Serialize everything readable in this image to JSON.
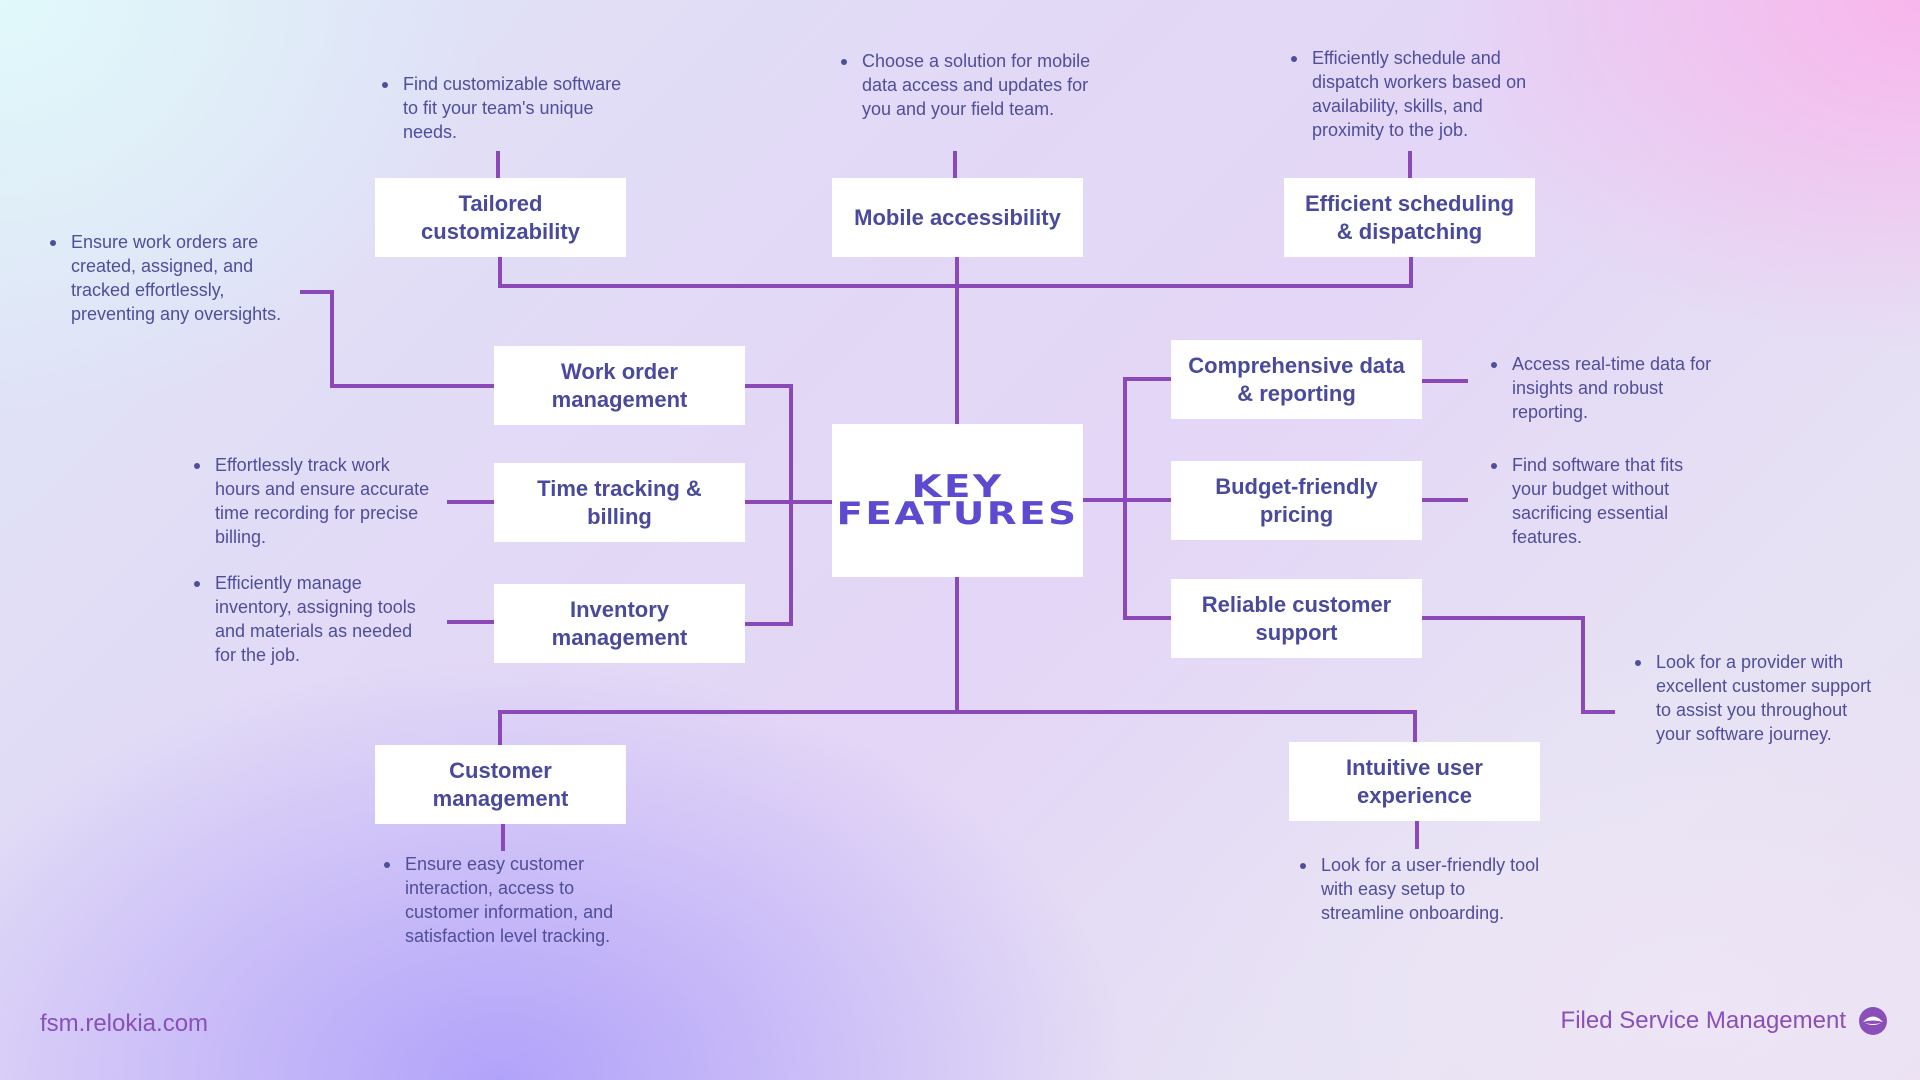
{
  "title": "KEY FEATURES",
  "colors": {
    "connector": "#8b48b8",
    "box_text": "#4a4a9c",
    "title_text": "#5c4bd0",
    "note_text": "#4e4e9a",
    "footer_text": "#8a4fb9"
  },
  "features": {
    "tailored": {
      "label": "Tailored customizability",
      "note": "Find customizable software to fit your team's unique needs."
    },
    "mobile": {
      "label": "Mobile accessibility",
      "note": "Choose a solution for mobile data access and updates for you and your field team."
    },
    "scheduling": {
      "label": "Efficient scheduling & dispatching",
      "note": "Efficiently schedule and dispatch workers based on availability, skills, and proximity to the job."
    },
    "work_order": {
      "label": "Work order management",
      "note": "Ensure work orders are created, assigned, and tracked effortlessly, preventing any oversights."
    },
    "time_tracking": {
      "label": "Time tracking & billing",
      "note": "Effortlessly track work hours and ensure accurate time recording for precise billing."
    },
    "inventory": {
      "label": "Inventory management",
      "note": "Efficiently manage inventory, assigning tools and materials as needed for the job."
    },
    "reporting": {
      "label": "Comprehensive data & reporting",
      "note": "Access real-time data for insights and robust reporting."
    },
    "pricing": {
      "label": "Budget-friendly pricing",
      "note": "Find software that fits your budget without sacrificing essential features."
    },
    "support": {
      "label": "Reliable customer support",
      "note": "Look for a provider with excellent customer support to assist you throughout your software journey."
    },
    "customer": {
      "label": "Customer management",
      "note": "Ensure easy customer interaction, access to customer information, and satisfaction level tracking."
    },
    "ux": {
      "label": "Intuitive user experience",
      "note": "Look for a user-friendly tool with easy setup to streamline onboarding."
    }
  },
  "footer": {
    "website": "fsm.relokia.com",
    "brand": "Filed Service Management",
    "logo_icon": "relokia-logo-icon"
  }
}
